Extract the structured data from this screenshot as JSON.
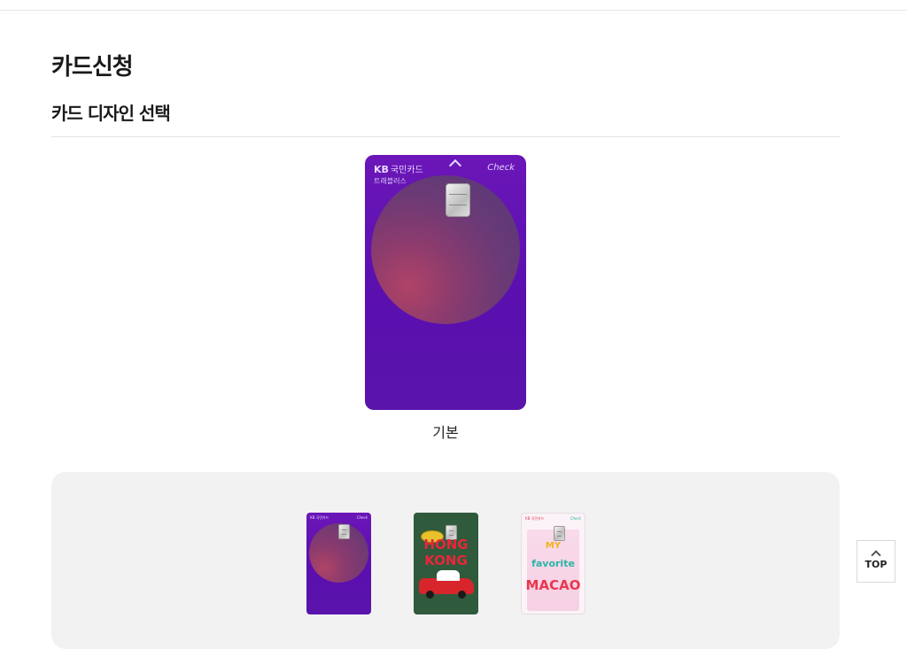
{
  "page": {
    "title": "카드신청",
    "section_title": "카드 디자인 선택"
  },
  "selected_card": {
    "brand_logo": "KB",
    "brand_name": "국민카드",
    "product": "트래블러스",
    "type_label": "Check",
    "caption": "기본"
  },
  "thumbnails": [
    {
      "name": "purple-default",
      "brand": "KB 국민카드",
      "check": "Check"
    },
    {
      "name": "hong-kong",
      "line1": "HONG",
      "line2": "KONG"
    },
    {
      "name": "macao",
      "brand": "KB 국민카드",
      "check": "Check",
      "word1": "MY",
      "word2": "favorite",
      "word3": "MACAO"
    }
  ],
  "top_button": {
    "label": "TOP"
  },
  "colors": {
    "card_purple": "#5a0fae",
    "panel_bg": "#f2f2f2"
  }
}
